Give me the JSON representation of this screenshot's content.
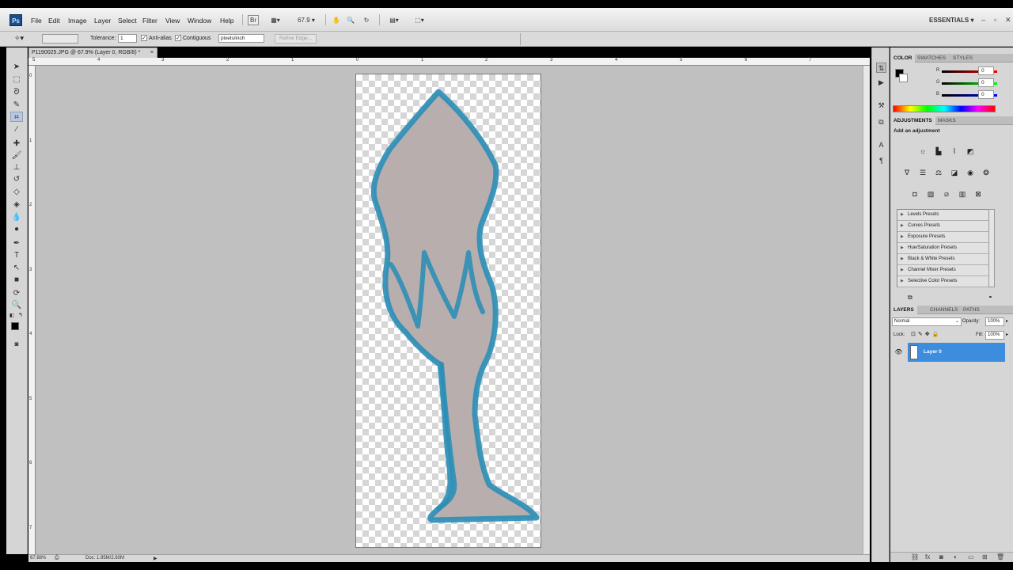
{
  "app": {
    "logo": "Ps",
    "workspace": "ESSENTIALS ▾"
  },
  "menus": [
    "File",
    "Edit",
    "Image",
    "Layer",
    "Select",
    "Filter",
    "View",
    "Window",
    "Help"
  ],
  "appbar": {
    "bridge_label": "Br",
    "zoom": "67.9"
  },
  "options": {
    "tolerance_label": "Tolerance:",
    "tolerance_value": "1",
    "antialias_label": "Anti-alias",
    "contiguous_label": "Contiguous",
    "units_value": "pixels/inch",
    "refine_edge_label": "Refine Edge..."
  },
  "document": {
    "tab_title": "P1190025.JPG @ 67.9% (Layer 0, RGB/8) *",
    "ruler_top_labels": [
      "5",
      "4",
      "3",
      "2",
      "1",
      "0",
      "1",
      "2",
      "3",
      "4",
      "5",
      "6",
      "7"
    ],
    "ruler_left_labels": [
      "0",
      "1",
      "2",
      "3",
      "4",
      "5",
      "6",
      "7"
    ]
  },
  "status": {
    "zoom": "67.88%",
    "doc_info": "Doc: 1.95M/2.60M"
  },
  "color_panel": {
    "tabs": [
      "COLOR",
      "SWATCHES",
      "STYLES"
    ],
    "channels": [
      {
        "label": "R",
        "value": "0",
        "color": "#d22020"
      },
      {
        "label": "G",
        "value": "0",
        "color": "#20b020"
      },
      {
        "label": "B",
        "value": "0",
        "color": "#2030d0"
      }
    ]
  },
  "adjustments_panel": {
    "tabs": [
      "ADJUSTMENTS",
      "MASKS"
    ],
    "heading": "Add an adjustment",
    "presets": [
      "Levels Presets",
      "Curves Presets",
      "Exposure Presets",
      "Hue/Saturation Presets",
      "Black & White Presets",
      "Channel Mixer Presets",
      "Selective Color Presets"
    ]
  },
  "layers_panel": {
    "tabs": [
      "LAYERS",
      "CHANNELS",
      "PATHS"
    ],
    "blend_mode": "Normal",
    "opacity_label": "Opacity:",
    "opacity_value": "100%",
    "lock_label": "Lock:",
    "fill_label": "Fill:",
    "fill_value": "100%",
    "layers": [
      {
        "name": "Layer 0",
        "selected": true
      }
    ]
  },
  "colors": {
    "selection_blue": "#3c8dde",
    "drawing_stroke": "#2e8fb6",
    "drawing_fill": "#b8aeae"
  }
}
